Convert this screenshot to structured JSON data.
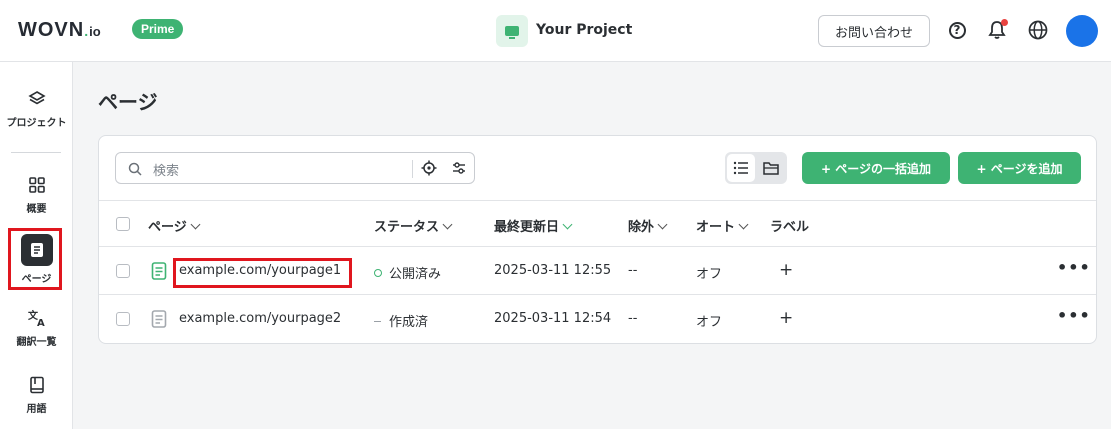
{
  "header": {
    "logo": "WOVN",
    "logo_suffix": "io",
    "plan_badge": "Prime",
    "project_name": "Your Project",
    "contact_label": "お問い合わせ"
  },
  "sidebar": {
    "items": [
      {
        "label": "プロジェクト",
        "icon": "layers-icon"
      },
      {
        "label": "概要",
        "icon": "grid-icon"
      },
      {
        "label": "ページ",
        "icon": "page-icon",
        "active": true
      },
      {
        "label": "翻訳一覧",
        "icon": "translate-icon"
      },
      {
        "label": "用語",
        "icon": "book-icon"
      }
    ]
  },
  "main": {
    "title": "ページ",
    "search_placeholder": "検索",
    "bulk_add_label": "+ ページの一括追加",
    "add_label": "+ ページを追加",
    "columns": [
      "ページ",
      "ステータス",
      "最終更新日",
      "除外",
      "オート",
      "ラベル"
    ],
    "rows": [
      {
        "url": "example.com/yourpage1",
        "status": "公開済み",
        "updated": "2025-03-11 12:55",
        "exclude": "--",
        "auto": "オフ",
        "label": "+",
        "highlighted": true
      },
      {
        "url": "example.com/yourpage2",
        "status": "作成済",
        "updated": "2025-03-11 12:54",
        "exclude": "--",
        "auto": "オフ",
        "label": "+"
      }
    ],
    "more_label": "•••"
  },
  "colors": {
    "accent": "#3eb373",
    "highlight": "#e0161e",
    "avatar": "#1a73e8",
    "notification_dot": "#e8423f"
  }
}
